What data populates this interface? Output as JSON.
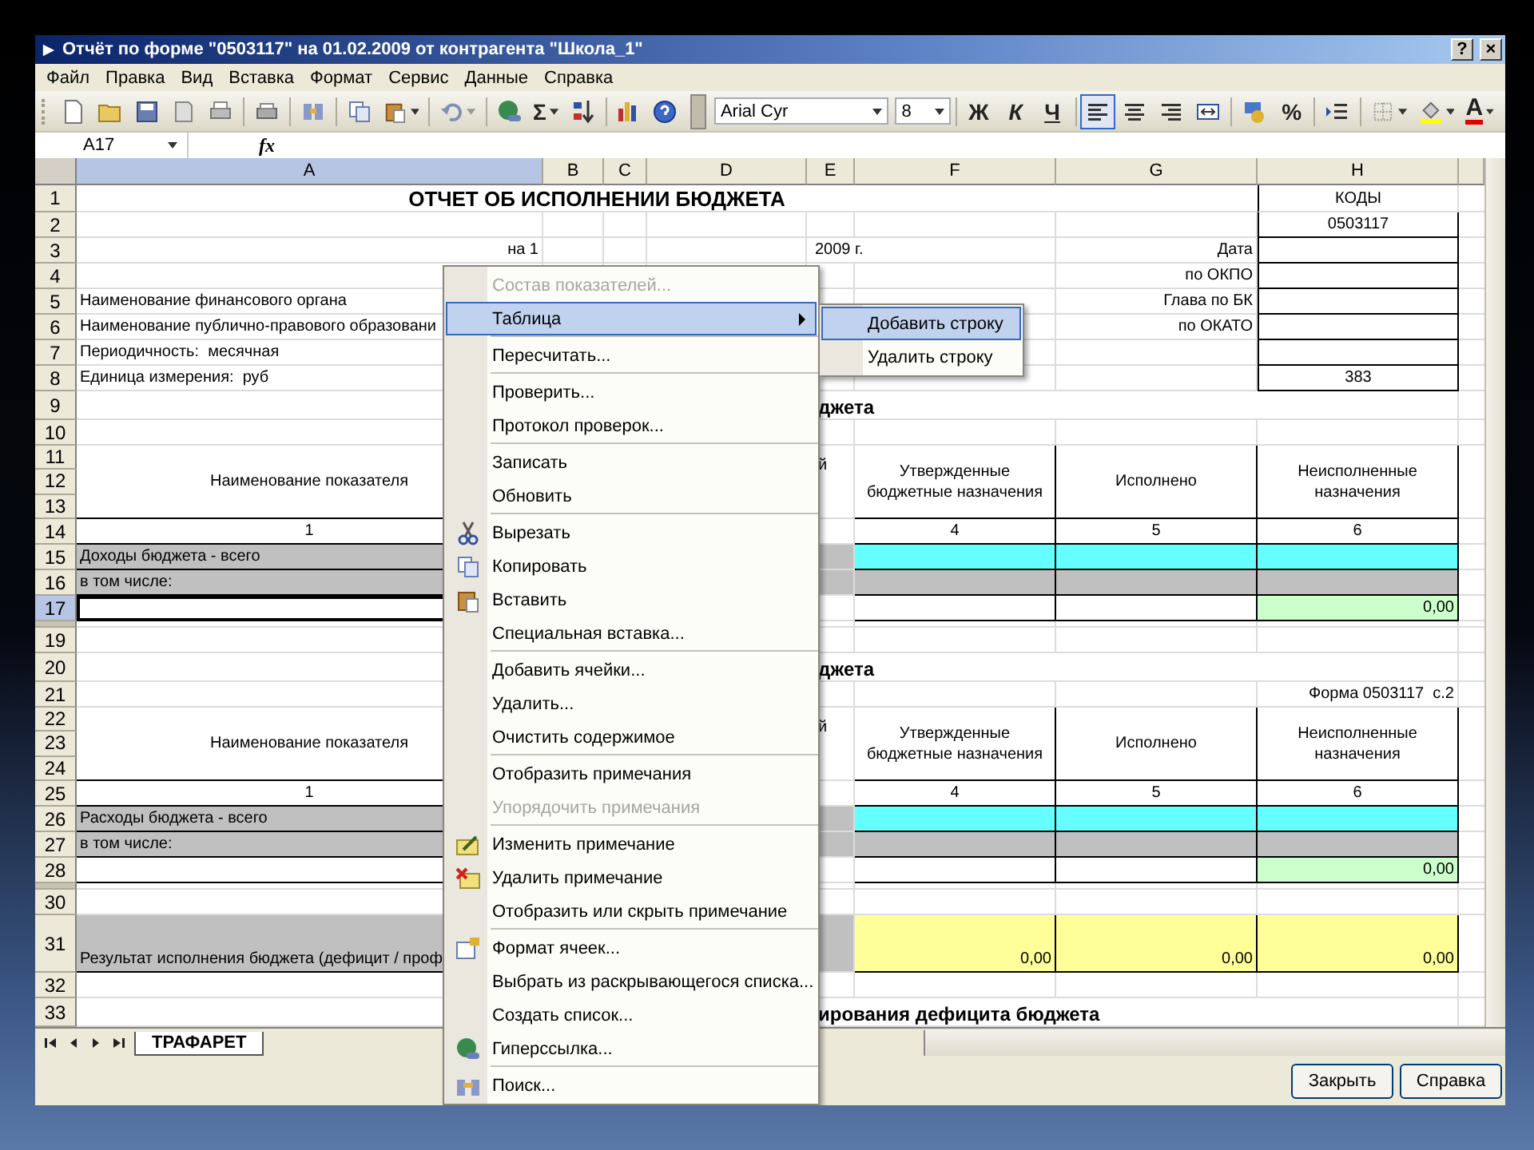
{
  "window": {
    "title": "Отчёт по форме \"0503117\" на 01.02.2009 от контрагента \"Школа_1\"",
    "help_button": "?",
    "close_button": "×"
  },
  "menu_bar": [
    "Файл",
    "Правка",
    "Вид",
    "Вставка",
    "Формат",
    "Сервис",
    "Данные",
    "Справка"
  ],
  "toolbar": {
    "sum_button": "Σ",
    "font": "Arial Cyr",
    "font_size": "8",
    "style_buttons": [
      "Ж",
      "К",
      "Ч"
    ],
    "align_buttons": [
      {
        "selected": true
      },
      {
        "selected": false
      },
      {
        "selected": false
      }
    ],
    "percent_button": "%",
    "font_color_button": "A"
  },
  "formula_bar": {
    "cell": "A17",
    "fx": "fx"
  },
  "sheet": {
    "columns": [
      {
        "label": "A",
        "selected": true
      },
      {
        "label": "B",
        "selected": false
      },
      {
        "label": "C",
        "selected": false
      },
      {
        "label": "D",
        "selected": false
      },
      {
        "label": "E",
        "selected": false
      },
      {
        "label": "F",
        "selected": false
      },
      {
        "label": "G",
        "selected": false
      },
      {
        "label": "H",
        "selected": false
      }
    ],
    "rows": [
      {
        "kind": "title",
        "numbers": [
          "1"
        ],
        "selected": false,
        "cells": {
          "a": "ОТЧЕТ ОБ ИСПОЛНЕНИИ БЮДЖЕТА",
          "h": "КОДЫ"
        }
      },
      {
        "kind": "field",
        "numbers": [
          "2"
        ],
        "selected": false,
        "cells": {
          "h": "0503117"
        }
      },
      {
        "kind": "date",
        "numbers": [
          "3"
        ],
        "selected": false,
        "cells": {
          "a": "на 1",
          "e": "2009 г.",
          "g": "Дата"
        }
      },
      {
        "kind": "field",
        "numbers": [
          "4"
        ],
        "selected": false,
        "cells": {
          "g": "по ОКПО"
        }
      },
      {
        "kind": "field",
        "numbers": [
          "5"
        ],
        "selected": false,
        "cells": {
          "a": "Наименование финансового органа",
          "g": "Глава по БК"
        }
      },
      {
        "kind": "field",
        "numbers": [
          "6"
        ],
        "selected": false,
        "cells": {
          "a": "Наименование публично-правового образовани",
          "g": "по ОКАТО"
        }
      },
      {
        "kind": "field",
        "numbers": [
          "7"
        ],
        "selected": false,
        "cells": {
          "a": "Периодичность:  месячная"
        }
      },
      {
        "kind": "field",
        "numbers": [
          "8"
        ],
        "selected": false,
        "cells": {
          "a": "Единица измерения:  руб",
          "h": "383"
        }
      },
      {
        "kind": "section",
        "numbers": [
          "9"
        ],
        "selected": false,
        "cells": {
          "e": "джета"
        }
      },
      {
        "kind": "blank",
        "numbers": [
          "10"
        ],
        "selected": false,
        "cells": {}
      },
      {
        "kind": "header",
        "numbers": [
          "11",
          "12",
          "13"
        ],
        "selected": false,
        "cells": {
          "a": "Наименование показателя",
          "e": "й",
          "f": "Утвержденные бюджетные назначения",
          "g": "Исполнено",
          "h": "Неисполненные назначения"
        }
      },
      {
        "kind": "numbers",
        "numbers": [
          "14"
        ],
        "selected": false,
        "cells": {
          "a": "1",
          "f": "4",
          "g": "5",
          "h": "6"
        }
      },
      {
        "kind": "total",
        "numbers": [
          "15"
        ],
        "selected": false,
        "cells": {
          "a": "Доходы бюджета - всего"
        }
      },
      {
        "kind": "subheader",
        "numbers": [
          "16"
        ],
        "selected": false,
        "cells": {
          "a": "в том числе:"
        }
      },
      {
        "kind": "input",
        "numbers": [
          "17"
        ],
        "selected": true,
        "cells": {
          "h": "0,00"
        }
      },
      {
        "kind": "collapsed",
        "selected": false,
        "cells": {}
      },
      {
        "kind": "blank",
        "numbers": [
          "19"
        ],
        "selected": false,
        "cells": {}
      },
      {
        "kind": "section",
        "numbers": [
          "20"
        ],
        "selected": false,
        "cells": {
          "e": "джета"
        }
      },
      {
        "kind": "form_ref",
        "numbers": [
          "21"
        ],
        "selected": false,
        "cells": {
          "h": "Форма 0503117  с.2"
        }
      },
      {
        "kind": "header",
        "numbers": [
          "22",
          "23",
          "24"
        ],
        "selected": false,
        "cells": {
          "a": "Наименование показателя",
          "e": "й",
          "f": "Утвержденные бюджетные назначения",
          "g": "Исполнено",
          "h": "Неисполненные назначения"
        }
      },
      {
        "kind": "numbers",
        "numbers": [
          "25"
        ],
        "selected": false,
        "cells": {
          "a": "1",
          "f": "4",
          "g": "5",
          "h": "6"
        }
      },
      {
        "kind": "total",
        "numbers": [
          "26"
        ],
        "selected": false,
        "cells": {
          "a": "Расходы бюджета - всего"
        }
      },
      {
        "kind": "subheader",
        "numbers": [
          "27"
        ],
        "selected": false,
        "cells": {
          "a": "в том числе:"
        }
      },
      {
        "kind": "input",
        "numbers": [
          "28"
        ],
        "selected": false,
        "cells": {
          "h": "0,00"
        }
      },
      {
        "kind": "collapsed",
        "selected": false,
        "cells": {}
      },
      {
        "kind": "blank",
        "numbers": [
          "30"
        ],
        "selected": false,
        "cells": {}
      },
      {
        "kind": "result",
        "numbers": [
          "31"
        ],
        "selected": false,
        "cells": {
          "a": "Результат исполнения бюджета (дефицит / проф",
          "f": "0,00",
          "g": "0,00",
          "h": "0,00"
        }
      },
      {
        "kind": "blank",
        "numbers": [
          "32"
        ],
        "selected": false,
        "cells": {}
      },
      {
        "kind": "section",
        "numbers": [
          "33"
        ],
        "selected": false,
        "cells": {
          "e": "ирования дефицита бюджета"
        }
      }
    ]
  },
  "sheet_tabs": [
    {
      "label": "ТРАФАРЕТ",
      "selected": true
    }
  ],
  "context_menu": {
    "groups": [
      [
        {
          "label": "Состав показателей...",
          "disabled": true,
          "selected": false,
          "submenu": false
        },
        {
          "label": "Таблица",
          "disabled": false,
          "selected": true,
          "submenu": true
        }
      ],
      [
        {
          "label": "Пересчитать...",
          "disabled": false,
          "selected": false,
          "submenu": false
        }
      ],
      [
        {
          "label": "Проверить...",
          "disabled": false,
          "selected": false,
          "submenu": false
        },
        {
          "label": "Протокол проверок...",
          "disabled": false,
          "selected": false,
          "submenu": false
        }
      ],
      [
        {
          "label": "Записать",
          "disabled": false,
          "selected": false,
          "submenu": false
        },
        {
          "label": "Обновить",
          "disabled": false,
          "selected": false,
          "submenu": false
        }
      ],
      [
        {
          "label": "Вырезать",
          "disabled": false,
          "selected": false,
          "submenu": false
        },
        {
          "label": "Копировать",
          "disabled": false,
          "selected": false,
          "submenu": false
        },
        {
          "label": "Вставить",
          "disabled": false,
          "selected": false,
          "submenu": false
        },
        {
          "label": "Специальная вставка...",
          "disabled": false,
          "selected": false,
          "submenu": false
        }
      ],
      [
        {
          "label": "Добавить ячейки...",
          "disabled": false,
          "selected": false,
          "submenu": false
        },
        {
          "label": "Удалить...",
          "disabled": false,
          "selected": false,
          "submenu": false
        },
        {
          "label": "Очистить содержимое",
          "disabled": false,
          "selected": false,
          "submenu": false
        }
      ],
      [
        {
          "label": "Отобразить примечания",
          "disabled": false,
          "selected": false,
          "submenu": false
        },
        {
          "label": "Упорядочить примечания",
          "disabled": true,
          "selected": false,
          "submenu": false
        }
      ],
      [
        {
          "label": "Изменить примечание",
          "disabled": false,
          "selected": false,
          "submenu": false
        },
        {
          "label": "Удалить примечание",
          "disabled": false,
          "selected": false,
          "submenu": false
        },
        {
          "label": "Отобразить или скрыть примечание",
          "disabled": false,
          "selected": false,
          "submenu": false
        }
      ],
      [
        {
          "label": "Формат ячеек...",
          "disabled": false,
          "selected": false,
          "submenu": false
        },
        {
          "label": "Выбрать из раскрывающегося списка...",
          "disabled": false,
          "selected": false,
          "submenu": false
        },
        {
          "label": "Создать список...",
          "disabled": false,
          "selected": false,
          "submenu": false
        },
        {
          "label": "Гиперссылка...",
          "disabled": false,
          "selected": false,
          "submenu": false
        }
      ],
      [
        {
          "label": "Поиск...",
          "disabled": false,
          "selected": false,
          "submenu": false
        }
      ]
    ]
  },
  "submenu": [
    {
      "label": "Добавить строку",
      "selected": true
    },
    {
      "label": "Удалить строку",
      "selected": false
    }
  ],
  "buttons": [
    "Закрыть",
    "Справка"
  ]
}
